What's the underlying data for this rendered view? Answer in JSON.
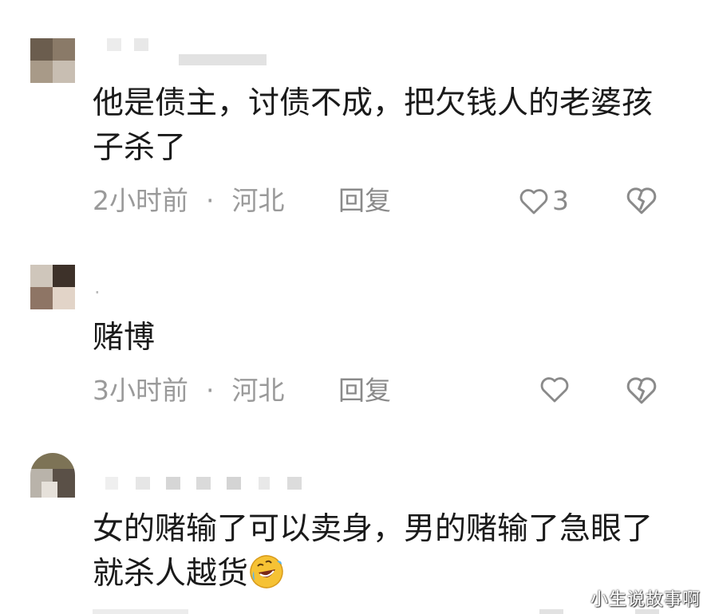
{
  "comments": [
    {
      "text": "他是债主，讨债不成，把欠钱人的老婆孩子杀了",
      "time": "2小时前",
      "location": "河北",
      "reply_label": "回复",
      "like_count": "3"
    },
    {
      "username_visible": ".",
      "text": "赌博",
      "time": "3小时前",
      "location": "河北",
      "reply_label": "回复",
      "like_count": ""
    },
    {
      "text": "女的赌输了可以卖身，男的赌输了急眼了就杀人越货",
      "time": "",
      "location": "",
      "reply_label": "",
      "like_count": ""
    }
  ],
  "separator": "·",
  "watermark": "小生说故事啊",
  "colors": {
    "text": "#1a1a1a",
    "meta": "#9a9a9a",
    "icon": "#8a8a8a"
  },
  "icons": [
    "heart-icon",
    "broken-heart-icon",
    "rofl-emoji"
  ]
}
